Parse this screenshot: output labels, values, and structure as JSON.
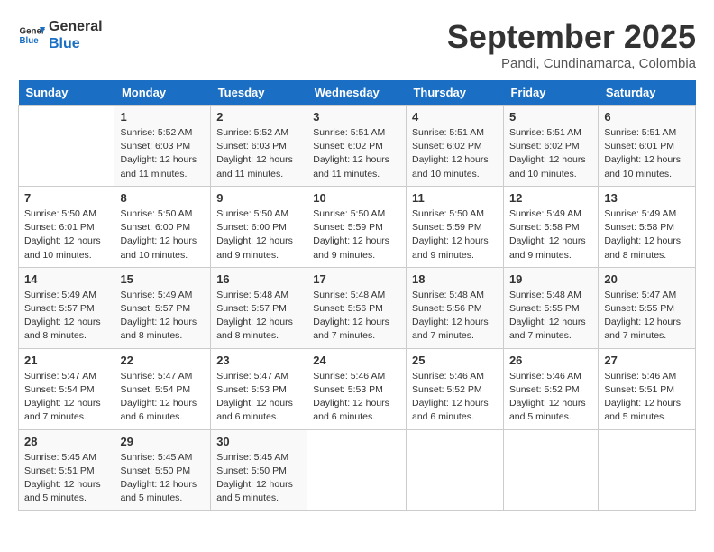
{
  "header": {
    "logo_line1": "General",
    "logo_line2": "Blue",
    "month": "September 2025",
    "location": "Pandi, Cundinamarca, Colombia"
  },
  "weekdays": [
    "Sunday",
    "Monday",
    "Tuesday",
    "Wednesday",
    "Thursday",
    "Friday",
    "Saturday"
  ],
  "weeks": [
    [
      {
        "day": "",
        "info": ""
      },
      {
        "day": "1",
        "info": "Sunrise: 5:52 AM\nSunset: 6:03 PM\nDaylight: 12 hours\nand 11 minutes."
      },
      {
        "day": "2",
        "info": "Sunrise: 5:52 AM\nSunset: 6:03 PM\nDaylight: 12 hours\nand 11 minutes."
      },
      {
        "day": "3",
        "info": "Sunrise: 5:51 AM\nSunset: 6:02 PM\nDaylight: 12 hours\nand 11 minutes."
      },
      {
        "day": "4",
        "info": "Sunrise: 5:51 AM\nSunset: 6:02 PM\nDaylight: 12 hours\nand 10 minutes."
      },
      {
        "day": "5",
        "info": "Sunrise: 5:51 AM\nSunset: 6:02 PM\nDaylight: 12 hours\nand 10 minutes."
      },
      {
        "day": "6",
        "info": "Sunrise: 5:51 AM\nSunset: 6:01 PM\nDaylight: 12 hours\nand 10 minutes."
      }
    ],
    [
      {
        "day": "7",
        "info": "Sunrise: 5:50 AM\nSunset: 6:01 PM\nDaylight: 12 hours\nand 10 minutes."
      },
      {
        "day": "8",
        "info": "Sunrise: 5:50 AM\nSunset: 6:00 PM\nDaylight: 12 hours\nand 10 minutes."
      },
      {
        "day": "9",
        "info": "Sunrise: 5:50 AM\nSunset: 6:00 PM\nDaylight: 12 hours\nand 9 minutes."
      },
      {
        "day": "10",
        "info": "Sunrise: 5:50 AM\nSunset: 5:59 PM\nDaylight: 12 hours\nand 9 minutes."
      },
      {
        "day": "11",
        "info": "Sunrise: 5:50 AM\nSunset: 5:59 PM\nDaylight: 12 hours\nand 9 minutes."
      },
      {
        "day": "12",
        "info": "Sunrise: 5:49 AM\nSunset: 5:58 PM\nDaylight: 12 hours\nand 9 minutes."
      },
      {
        "day": "13",
        "info": "Sunrise: 5:49 AM\nSunset: 5:58 PM\nDaylight: 12 hours\nand 8 minutes."
      }
    ],
    [
      {
        "day": "14",
        "info": "Sunrise: 5:49 AM\nSunset: 5:57 PM\nDaylight: 12 hours\nand 8 minutes."
      },
      {
        "day": "15",
        "info": "Sunrise: 5:49 AM\nSunset: 5:57 PM\nDaylight: 12 hours\nand 8 minutes."
      },
      {
        "day": "16",
        "info": "Sunrise: 5:48 AM\nSunset: 5:57 PM\nDaylight: 12 hours\nand 8 minutes."
      },
      {
        "day": "17",
        "info": "Sunrise: 5:48 AM\nSunset: 5:56 PM\nDaylight: 12 hours\nand 7 minutes."
      },
      {
        "day": "18",
        "info": "Sunrise: 5:48 AM\nSunset: 5:56 PM\nDaylight: 12 hours\nand 7 minutes."
      },
      {
        "day": "19",
        "info": "Sunrise: 5:48 AM\nSunset: 5:55 PM\nDaylight: 12 hours\nand 7 minutes."
      },
      {
        "day": "20",
        "info": "Sunrise: 5:47 AM\nSunset: 5:55 PM\nDaylight: 12 hours\nand 7 minutes."
      }
    ],
    [
      {
        "day": "21",
        "info": "Sunrise: 5:47 AM\nSunset: 5:54 PM\nDaylight: 12 hours\nand 7 minutes."
      },
      {
        "day": "22",
        "info": "Sunrise: 5:47 AM\nSunset: 5:54 PM\nDaylight: 12 hours\nand 6 minutes."
      },
      {
        "day": "23",
        "info": "Sunrise: 5:47 AM\nSunset: 5:53 PM\nDaylight: 12 hours\nand 6 minutes."
      },
      {
        "day": "24",
        "info": "Sunrise: 5:46 AM\nSunset: 5:53 PM\nDaylight: 12 hours\nand 6 minutes."
      },
      {
        "day": "25",
        "info": "Sunrise: 5:46 AM\nSunset: 5:52 PM\nDaylight: 12 hours\nand 6 minutes."
      },
      {
        "day": "26",
        "info": "Sunrise: 5:46 AM\nSunset: 5:52 PM\nDaylight: 12 hours\nand 5 minutes."
      },
      {
        "day": "27",
        "info": "Sunrise: 5:46 AM\nSunset: 5:51 PM\nDaylight: 12 hours\nand 5 minutes."
      }
    ],
    [
      {
        "day": "28",
        "info": "Sunrise: 5:45 AM\nSunset: 5:51 PM\nDaylight: 12 hours\nand 5 minutes."
      },
      {
        "day": "29",
        "info": "Sunrise: 5:45 AM\nSunset: 5:50 PM\nDaylight: 12 hours\nand 5 minutes."
      },
      {
        "day": "30",
        "info": "Sunrise: 5:45 AM\nSunset: 5:50 PM\nDaylight: 12 hours\nand 5 minutes."
      },
      {
        "day": "",
        "info": ""
      },
      {
        "day": "",
        "info": ""
      },
      {
        "day": "",
        "info": ""
      },
      {
        "day": "",
        "info": ""
      }
    ]
  ]
}
